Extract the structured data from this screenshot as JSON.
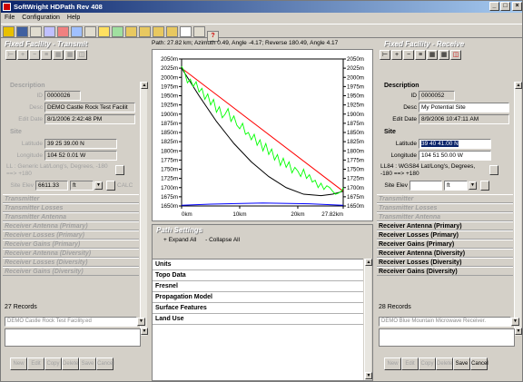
{
  "app": {
    "title": "SoftWright HDPath Rev 408"
  },
  "menu": [
    "File",
    "Configuration",
    "Help"
  ],
  "path_info": "Path: 27.82 km; Azimuth 0.49, Angle -4.17; Reverse 180.49, Angle 4.17",
  "left": {
    "header": "Fixed Facility - Transmit",
    "description_label": "Description",
    "id_label": "ID",
    "id": "0000026",
    "desc_label": "Desc",
    "desc": "DEMO Castle Rock Test Facilit",
    "editdate_label": "Edit Date",
    "editdate": "8/1/2006 2:42:48 PM",
    "site_label": "Site",
    "lat_label": "Latitude",
    "lat": "39 25 39.00 N",
    "lon_label": "Longitude",
    "lon": "104 52 0.01 W",
    "ll_note": "LL : Generic Lat/Long's, Degrees, -180 ==> +180",
    "elev_label": "Site Elev",
    "elev": "6611.33",
    "elev_unit": "ft",
    "calc": "CALC",
    "sections": [
      "Transmitter",
      "Transmitter Losses",
      "Transmitter Antenna",
      "Receiver Antenna (Primary)",
      "Receiver Losses (Primary)",
      "Receiver Gains (Primary)",
      "Receiver Antenna (Diversity)",
      "Receiver Losses (Diversity)",
      "Receiver Gains (Diversity)"
    ],
    "records": "27 Records",
    "combo": "DEMO Castle Rock Test Facility.ed"
  },
  "right": {
    "header": "Fixed Facility - Receive",
    "description_label": "Description",
    "id_label": "ID",
    "id": "0000052",
    "desc_label": "Desc",
    "desc": "My Potential Site",
    "editdate_label": "Edit Date",
    "editdate": "8/9/2006 10:47:11 AM",
    "site_label": "Site",
    "lat_label": "Latitude",
    "lat": "39 40 41.00 N",
    "lon_label": "Longitude",
    "lon": "104 51 50.00 W",
    "ll_note": "LL84 : WGS84 Lat/Long's, Degrees, -180 ==> +180",
    "elev_label": "Site Elev",
    "elev_unit": "ft",
    "sections_dis": [
      "Transmitter",
      "Transmitter Losses",
      "Transmitter Antenna"
    ],
    "sections": [
      "Receiver Antenna (Primary)",
      "Receiver Losses (Primary)",
      "Receiver Gains (Primary)",
      "Receiver Antenna (Diversity)",
      "Receiver Losses (Diversity)",
      "Receiver Gains (Diversity)"
    ],
    "records": "28 Records",
    "combo": "DEMO Blue Mountain Microwave Receiver."
  },
  "buttons": [
    "New",
    "Edit",
    "Copy",
    "Delete",
    "Save",
    "Cancel"
  ],
  "path_settings": {
    "title": "Path Settings",
    "expand": "+ Expand All",
    "collapse": "- Collapse All",
    "rows": [
      "Units",
      "Topo Data",
      "Fresnel",
      "Propagation Model",
      "Surface Features",
      "Land Use"
    ]
  },
  "chart_data": {
    "type": "line",
    "yticks": [
      "2050m",
      "2025m",
      "2000m",
      "1975m",
      "1950m",
      "1925m",
      "1900m",
      "1875m",
      "1850m",
      "1825m",
      "1800m",
      "1775m",
      "1750m",
      "1725m",
      "1700m",
      "1675m",
      "1650m"
    ],
    "xticks": [
      "0km",
      "10km",
      "20km",
      "27.82km"
    ],
    "ylim": [
      1650,
      2050
    ],
    "xlim": [
      0,
      27.82
    ],
    "series": [
      {
        "color": "#ff0000",
        "x": [
          0,
          27.82
        ],
        "y": [
          2025,
          1690
        ]
      },
      {
        "color": "#000000",
        "x": [
          0,
          3,
          6,
          9,
          12,
          15,
          18,
          21,
          24,
          26,
          27.82
        ],
        "y": [
          2025,
          1950,
          1880,
          1820,
          1770,
          1730,
          1700,
          1682,
          1678,
          1682,
          1690
        ]
      },
      {
        "color": "#00ff00",
        "x": [
          0,
          0.5,
          1,
          1.5,
          2,
          2.5,
          3,
          3.5,
          4,
          4.5,
          5,
          5.5,
          6,
          6.5,
          7,
          7.5,
          8,
          8.5,
          9,
          9.5,
          10,
          10.5,
          11,
          11.5,
          12,
          12.5,
          13,
          13.5,
          14,
          14.5,
          15,
          15.5,
          16,
          16.5,
          17,
          17.5,
          18,
          18.5,
          19,
          19.5,
          20,
          20.5,
          21,
          21.5,
          22,
          22.5,
          23,
          23.5,
          24,
          24.5,
          25,
          25.5,
          26,
          26.5,
          27,
          27.5,
          27.82
        ],
        "y": [
          2030,
          2015,
          1985,
          1995,
          1975,
          1988,
          1960,
          1970,
          1940,
          1955,
          1925,
          1940,
          1905,
          1920,
          1890,
          1900,
          1915,
          1880,
          1895,
          1870,
          1860,
          1875,
          1845,
          1850,
          1830,
          1845,
          1815,
          1830,
          1800,
          1820,
          1790,
          1805,
          1775,
          1790,
          1760,
          1780,
          1755,
          1770,
          1740,
          1755,
          1745,
          1730,
          1750,
          1725,
          1735,
          1715,
          1720,
          1700,
          1712,
          1695,
          1705,
          1700,
          1690,
          1682,
          1685,
          1690,
          1700
        ]
      },
      {
        "color": "#0000ff",
        "x": [
          0,
          5,
          14,
          22,
          27.82
        ],
        "y": [
          1652,
          1655,
          1658,
          1656,
          1652
        ]
      }
    ]
  }
}
